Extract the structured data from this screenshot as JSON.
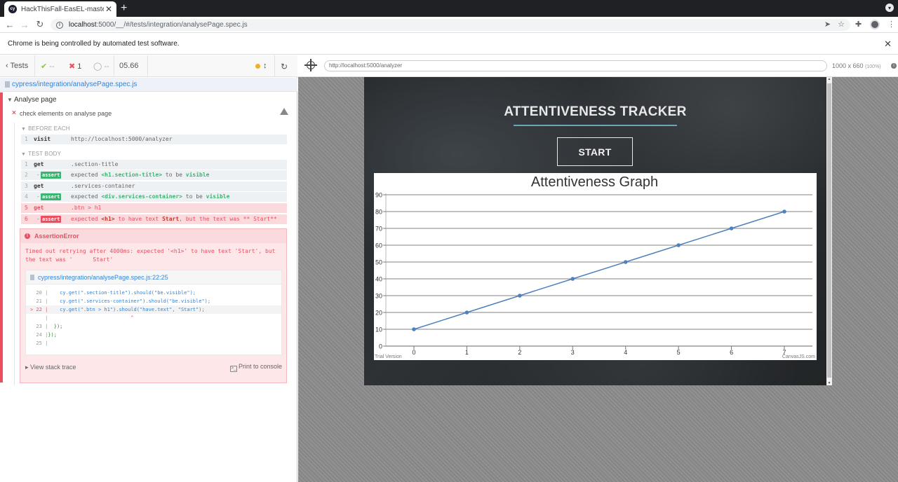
{
  "browser": {
    "tab_title": "HackThisFall-EasEL-master-ba",
    "tab_icon": "cy",
    "url_host": "localhost",
    "url_rest": ":5000/__/#/tests/integration/analysePage.spec.js",
    "infobar_text": "Chrome is being controlled by automated test software."
  },
  "reporter": {
    "tests_label": "Tests",
    "passed": "--",
    "failed": "1",
    "pending": "--",
    "duration": "05.66",
    "spec_path": "cypress/integration/analysePage.spec.js",
    "suite_title": "Analyse page",
    "test_title": "check elements on analyse page",
    "before_each_label": "BEFORE EACH",
    "test_body_label": "TEST BODY",
    "before_each": [
      {
        "num": "1",
        "name": "visit",
        "msg": "http://localhost:5000/analyzer"
      }
    ],
    "commands": [
      {
        "num": "1",
        "name": "get",
        "msg": ".section-title"
      },
      {
        "num": "2",
        "badge": "assert",
        "pre": "expected ",
        "el": "<h1.section-title>",
        "mid": " to be ",
        "val": "visible"
      },
      {
        "num": "3",
        "name": "get",
        "msg": ".services-container"
      },
      {
        "num": "4",
        "badge": "assert",
        "pre": "expected ",
        "el": "<div.services-container>",
        "mid": " to be ",
        "val": "visible"
      },
      {
        "num": "5",
        "name": "get",
        "msg": ".btn > h1"
      },
      {
        "num": "6",
        "badge": "assert",
        "pre": "expected ",
        "el": "<h1>",
        "mid": " to have text ",
        "val": "Start",
        "post": ", but the text was ** Start**"
      }
    ],
    "error": {
      "name": "AssertionError",
      "message": "Timed out retrying after 4000ms: expected '<h1>' to have text 'Start', but\nthe text was '      Start'",
      "code_path": "cypress/integration/analysePage.spec.js:22:25",
      "code_lines": [
        {
          "gutter": "  20 |",
          "code": "    cy.get(\".section-title\").should(\"be.visible\");"
        },
        {
          "gutter": "  21 |",
          "code": "    cy.get(\".services-container\").should(\"be.visible\");"
        },
        {
          "gutter": "> 22 |",
          "code": "    cy.get(\".btn > h1\").should(\"have.text\", \"Start\");"
        },
        {
          "gutter": "     |",
          "code": "                            ^"
        },
        {
          "gutter": "  23 |",
          "code": "  });"
        },
        {
          "gutter": "  24 |",
          "code": "});"
        },
        {
          "gutter": "  25 |",
          "code": ""
        }
      ],
      "stack_label": "View stack trace",
      "print_label": "Print to console"
    }
  },
  "aut": {
    "url": "http://localhost:5000/analyzer",
    "size": "1000 x 660",
    "zoom": "(100%)",
    "app_title": "ATTENTIVENESS TRACKER",
    "start_label": "START"
  },
  "chart_data": {
    "type": "line",
    "title": "Attentiveness Graph",
    "x": [
      0,
      1,
      2,
      3,
      4,
      5,
      6,
      7
    ],
    "series": [
      {
        "values": [
          10,
          20,
          30,
          40,
          50,
          60,
          70,
          80
        ],
        "color": "#4f81bc"
      }
    ],
    "ylim": [
      0,
      90
    ],
    "yticks": [
      0,
      10,
      20,
      30,
      40,
      50,
      60,
      70,
      80,
      90
    ],
    "grid": true,
    "watermark_left": "Trial Version",
    "watermark_right": "CanvasJS.com"
  }
}
